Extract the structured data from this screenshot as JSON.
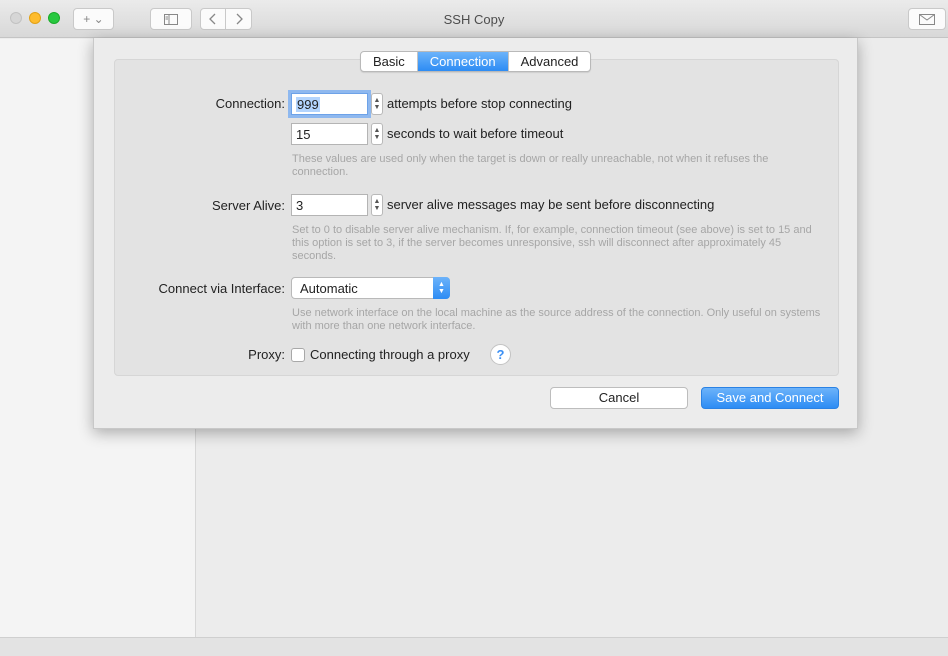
{
  "window": {
    "title": "SSH Copy"
  },
  "toolbar": {
    "add_label": "+ ⌄",
    "sidebar_icon": "sidebar-icon",
    "back_icon": "chevron-left-icon",
    "forward_icon": "chevron-right-icon",
    "mail_icon": "envelope-icon"
  },
  "tabs": [
    {
      "label": "Basic",
      "active": false
    },
    {
      "label": "Connection",
      "active": true
    },
    {
      "label": "Advanced",
      "active": false
    }
  ],
  "connection": {
    "label": "Connection:",
    "attempts_value": "999",
    "attempts_text": "attempts before stop connecting",
    "timeout_value": "15",
    "timeout_text": "seconds to wait before timeout",
    "help": "These values are used only when the target is down or really unreachable, not when it refuses the connection."
  },
  "server_alive": {
    "label": "Server Alive:",
    "value": "3",
    "text": "server alive messages may be sent before disconnecting",
    "help": "Set to 0 to disable server alive mechanism. If, for example, connection timeout (see above) is set to 15 and this option is set to 3, if the server becomes unresponsive, ssh will disconnect after approximately 45 seconds."
  },
  "interface": {
    "label": "Connect via Interface:",
    "selected": "Automatic",
    "help": "Use network interface on the local machine as the source address of the connection. Only useful on systems with more than one network interface."
  },
  "proxy": {
    "label": "Proxy:",
    "checkbox_label": "Connecting through a proxy",
    "checked": false,
    "help_glyph": "?"
  },
  "buttons": {
    "cancel": "Cancel",
    "save": "Save and Connect"
  },
  "colors": {
    "accent": "#2d8cf4",
    "help_text": "#a6a6a6"
  }
}
